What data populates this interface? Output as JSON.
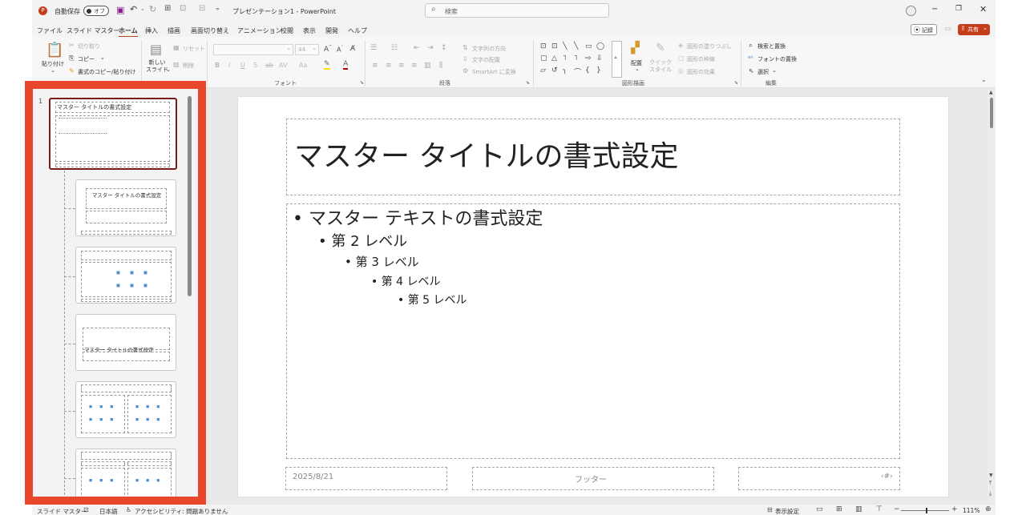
{
  "titlebar": {
    "autosave_label": "自動保存",
    "toggle_label": "オフ",
    "doc_title": "プレゼンテーション1 - PowerPoint",
    "search_placeholder": "検索"
  },
  "menu": {
    "tabs": [
      "ファイル",
      "スライド マスター",
      "ホーム",
      "挿入",
      "描画",
      "画面切り替え",
      "アニメーション",
      "校閲",
      "表示",
      "開発",
      "ヘルプ"
    ],
    "active": "ホーム",
    "record_label": "記録",
    "share_label": "共有"
  },
  "ribbon": {
    "clipboard": {
      "paste": "貼り付け",
      "cut": "切り取り",
      "copy": "コピー",
      "format_painter": "書式のコピー/貼り付け"
    },
    "slides": {
      "new_slide": "新しい\nスライド",
      "reset": "リセット",
      "delete": "削除"
    },
    "font": {
      "size": "44",
      "group_label": "フォント"
    },
    "paragraph": {
      "text_direction": "文字列の方向",
      "align_text": "文字の配置",
      "smartart": "SmartArt に変換",
      "group_label": "段落"
    },
    "drawing": {
      "arrange": "配置",
      "quick_styles": "クイック\nスタイル",
      "shape_fill": "図形の塗りつぶし",
      "shape_outline": "図形の枠線",
      "shape_effects": "図形の効果",
      "group_label": "図形描画"
    },
    "editing": {
      "find_replace": "検索と置換",
      "replace_fonts": "フォントの置換",
      "select": "選択",
      "group_label": "編集"
    }
  },
  "thumbnails": {
    "slide_number": "1",
    "master_title": "マスター タイトルの書式設定",
    "title_layout": "マスター タイトルの書式設定",
    "section_title": "マスター タイトルの書式設定"
  },
  "slide": {
    "title": "マスター タイトルの書式設定",
    "bullets": [
      "マスター テキストの書式設定",
      "第 2 レベル",
      "第 3 レベル",
      "第 4 レベル",
      "第 5 レベル"
    ],
    "date": "2025/8/21",
    "footer": "フッター",
    "page_number": "‹#›"
  },
  "statusbar": {
    "view": "スライド マスター",
    "language": "日本語",
    "accessibility": "アクセシビリティ: 問題ありません",
    "display_settings": "表示設定",
    "zoom": "111%"
  },
  "colors": {
    "accent": "#c43e1c",
    "highlight_box": "#e8472c",
    "selected_thumb": "#7b1a1a"
  }
}
